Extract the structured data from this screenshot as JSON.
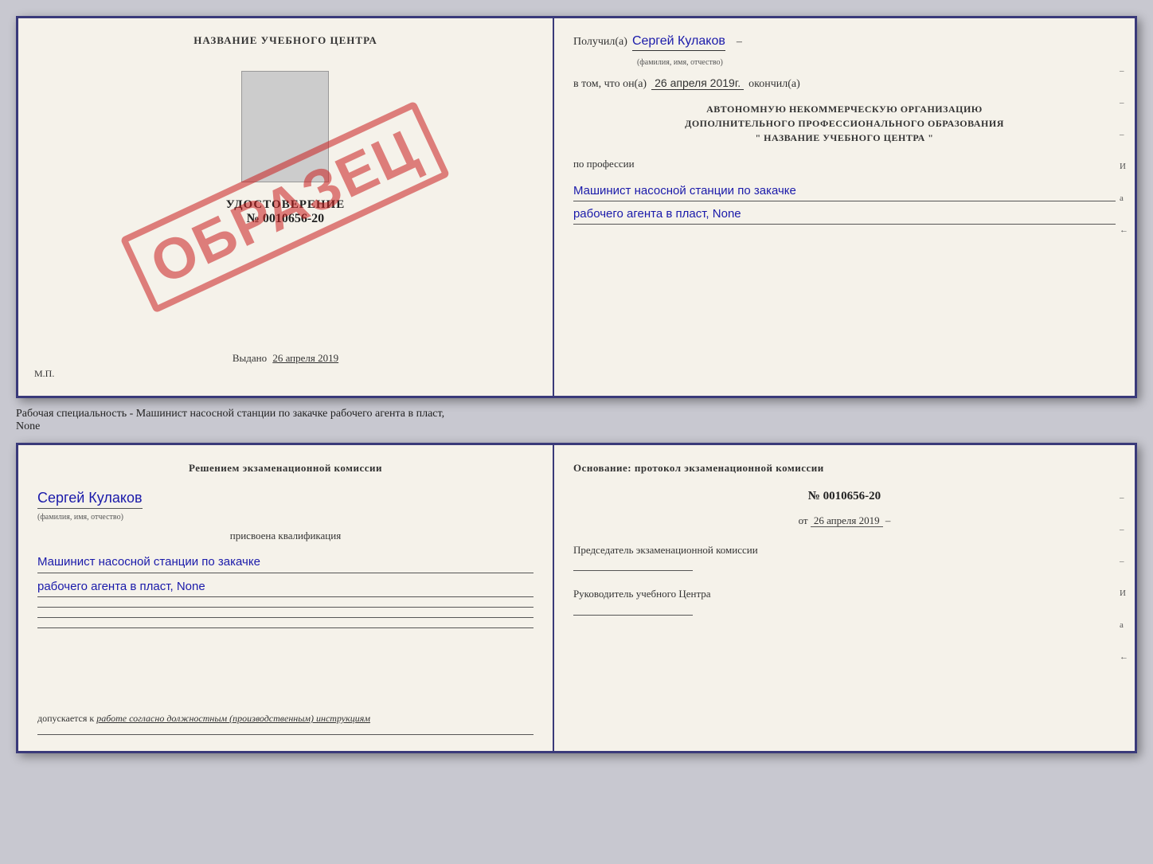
{
  "top_document": {
    "left": {
      "title": "НАЗВАНИЕ УЧЕБНОГО ЦЕНТРА",
      "obrazets": "ОБРАЗЕЦ",
      "udostoverenie_label": "УДОСТОВЕРЕНИЕ",
      "number": "№ 0010656-20",
      "vydano_label": "Выдано",
      "vydano_date": "26 апреля 2019",
      "mp": "М.П."
    },
    "right": {
      "poluchil_label": "Получил(а)",
      "recipient_name": "Сергей Кулаков",
      "fio_hint": "(фамилия, имя, отчество)",
      "vtom_label": "в том, что он(а)",
      "date_value": "26 апреля 2019г.",
      "okonchil_label": "окончил(а)",
      "org_line1": "АВТОНОМНУЮ НЕКОММЕРЧЕСКУЮ ОРГАНИЗАЦИЮ",
      "org_line2": "ДОПОЛНИТЕЛЬНОГО ПРОФЕССИОНАЛЬНОГО ОБРАЗОВАНИЯ",
      "org_line3": "\"   НАЗВАНИЕ УЧЕБНОГО ЦЕНТРА   \"",
      "po_professii": "по профессии",
      "profession_line1": "Машинист насосной станции по закачке",
      "profession_line2": "рабочего агента в пласт, None",
      "right_lines": [
        "-",
        "-",
        "-",
        "И",
        "а",
        "←"
      ]
    }
  },
  "between": {
    "text1": "Рабочая специальность - Машинист насосной станции по закачке рабочего агента в пласт,",
    "text2": "None"
  },
  "bottom_document": {
    "left": {
      "commission_title": "Решением  экзаменационной  комиссии",
      "person_name": "Сергей Кулаков",
      "fio_hint": "(фамилия, имя, отчество)",
      "prisvoena": "присвоена квалификация",
      "qualification_line1": "Машинист насосной станции по закачке",
      "qualification_line2": "рабочего агента в пласт, None",
      "dopuskaetsya_label": "допускается к",
      "dopuskaetsya_value": "работе согласно должностным (производственным) инструкциям"
    },
    "right": {
      "osnovaniye": "Основание:  протокол  экзаменационной  комиссии",
      "protocol_num": "№  0010656-20",
      "protocol_date_label": "от",
      "protocol_date": "26 апреля 2019",
      "predsedatel_label": "Председатель экзаменационной комиссии",
      "rukovoditel_label": "Руководитель учебного Центра",
      "right_lines": [
        "-",
        "-",
        "-",
        "И",
        "а",
        "←"
      ]
    }
  }
}
